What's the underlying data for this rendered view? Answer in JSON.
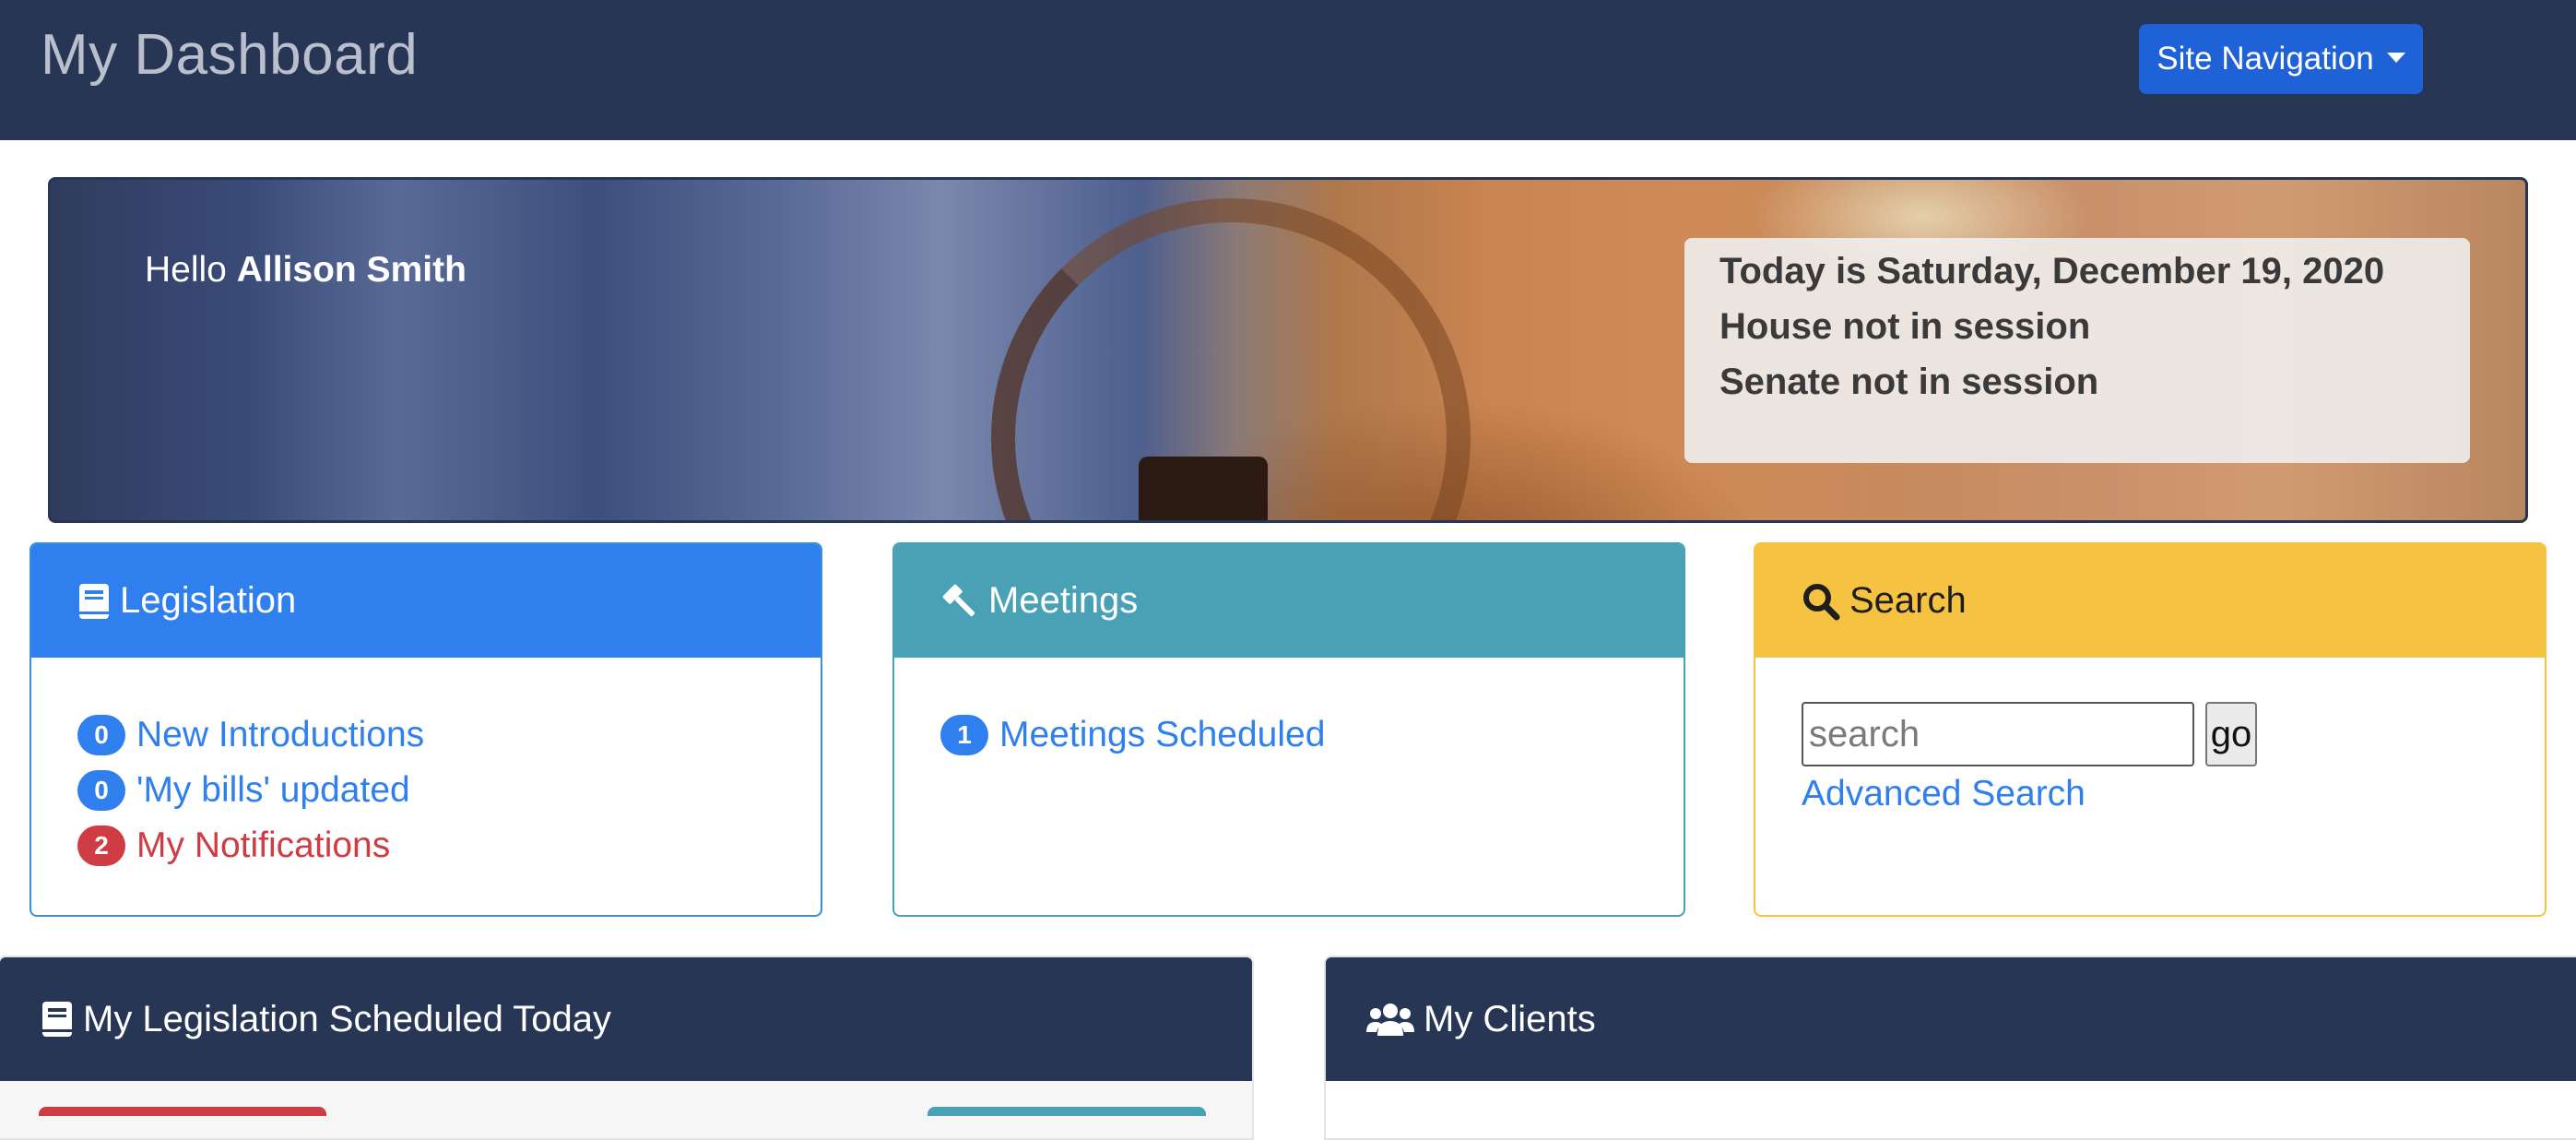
{
  "header": {
    "title": "My Dashboard",
    "site_nav_label": "Site Navigation"
  },
  "banner": {
    "greeting": "Hello",
    "user_name": "Allison Smith",
    "status_lines": [
      "Today is Saturday, December 19, 2020",
      "House not in session",
      "Senate not in session"
    ]
  },
  "cards": {
    "legislation": {
      "title": "Legislation",
      "icon": "book-icon",
      "items": [
        {
          "count": "0",
          "label": "New Introductions",
          "color": "#2f7fef"
        },
        {
          "count": "0",
          "label": "'My bills' updated",
          "color": "#2f7fef"
        },
        {
          "count": "2",
          "label": "My Notifications",
          "color": "#d03c43"
        }
      ]
    },
    "meetings": {
      "title": "Meetings",
      "icon": "gavel-icon",
      "items": [
        {
          "count": "1",
          "label": "Meetings Scheduled",
          "color": "#2f7fef"
        }
      ]
    },
    "search": {
      "title": "Search",
      "icon": "search-icon",
      "placeholder": "search",
      "go_label": "go",
      "advanced_label": "Advanced Search"
    }
  },
  "panels": {
    "legislation_today": {
      "title": "My Legislation Scheduled Today",
      "icon": "book-icon"
    },
    "clients": {
      "title": "My Clients",
      "icon": "users-icon"
    }
  },
  "colors": {
    "navbar": "#283655",
    "primary": "#2f7fef",
    "info": "#49a1b6",
    "warning": "#f6c242",
    "danger": "#d03c43"
  }
}
